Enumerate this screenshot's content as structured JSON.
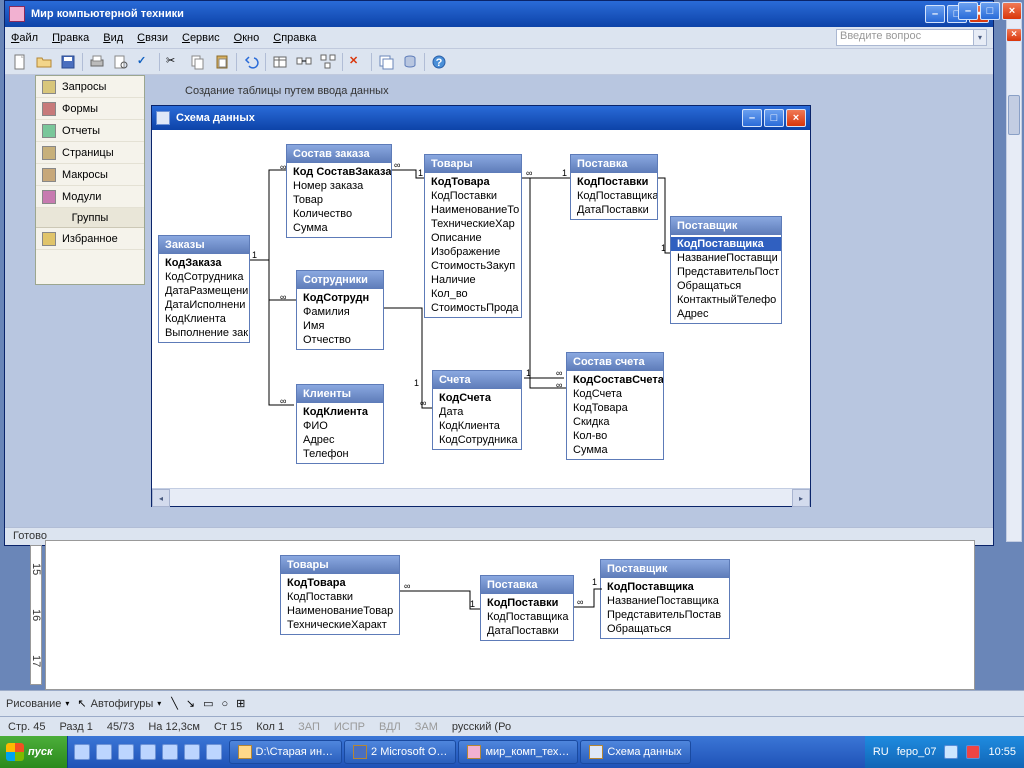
{
  "access_window": {
    "title": "Мир компьютерной техники",
    "menu": [
      "Файл",
      "Правка",
      "Вид",
      "Связи",
      "Сервис",
      "Окно",
      "Справка"
    ],
    "search_placeholder": "Введите вопрос",
    "nav": {
      "queries": "Запросы",
      "forms": "Формы",
      "reports": "Отчеты",
      "pages": "Страницы",
      "macros": "Макросы",
      "modules": "Модули",
      "groups_hdr": "Группы",
      "favorites": "Избранное"
    },
    "wizard_hint": "Создание таблицы путем ввода данных",
    "status": "Готово"
  },
  "schema_window": {
    "title": "Схема данных"
  },
  "tables": {
    "zakazy": {
      "title": "Заказы",
      "fields": [
        "КодЗаказа",
        "КодСотрудника",
        "ДатаРазмещени",
        "ДатаИсполнени",
        "КодКлиента",
        "Выполнение зак"
      ]
    },
    "sostav_zakaza": {
      "title": "Состав заказа",
      "fields": [
        "Код СоставЗаказа",
        "Номер заказа",
        "Товар",
        "Количество",
        "Сумма"
      ]
    },
    "tovary": {
      "title": "Товары",
      "fields": [
        "КодТовара",
        "КодПоставки",
        "НаименованиеТо",
        "ТехническиеХар",
        "Описание",
        "Изображение",
        "СтоимостьЗакуп",
        "Наличие",
        "Кол_во",
        "СтоимостьПрода"
      ]
    },
    "postavka": {
      "title": "Поставка",
      "fields": [
        "КодПоставки",
        "КодПоставщика",
        "ДатаПоставки"
      ]
    },
    "postavshik": {
      "title": "Поставщик",
      "fields": [
        "КодПоставщика",
        "НазваниеПоставщи",
        "ПредставительПост",
        "Обращаться",
        "КонтактныйТелефо",
        "Адрес"
      ]
    },
    "sotrudniki": {
      "title": "Сотрудники",
      "fields": [
        "КодСотрудн",
        "Фамилия",
        "Имя",
        "Отчество"
      ]
    },
    "klienty": {
      "title": "Клиенты",
      "fields": [
        "КодКлиента",
        "ФИО",
        "Адрес",
        "Телефон"
      ]
    },
    "scheta": {
      "title": "Счета",
      "fields": [
        "КодСчета",
        "Дата",
        "КодКлиента",
        "КодСотрудника"
      ]
    },
    "sostav_scheta": {
      "title": "Состав счета",
      "fields": [
        "КодСоставСчета",
        "КодСчета",
        "КодТовара",
        "Скидка",
        "Кол-во",
        "Сумма"
      ]
    }
  },
  "rel_labels": {
    "one": "1",
    "many": "∞"
  },
  "below": {
    "tovary": {
      "title": "Товары",
      "fields": [
        "КодТовара",
        "КодПоставки",
        "НаименованиеТовар",
        "ТехническиеХаракт"
      ]
    },
    "postavka": {
      "title": "Поставка",
      "fields": [
        "КодПоставки",
        "КодПоставщика",
        "ДатаПоставки"
      ]
    },
    "postavshik": {
      "title": "Поставщик",
      "fields": [
        "КодПоставщика",
        "НазваниеПоставщика",
        "ПредставительПостав",
        "Обращаться"
      ]
    }
  },
  "word": {
    "draw_label": "Рисование",
    "autoshapes": "Автофигуры",
    "status": {
      "page": "Стр.  45",
      "section": "Разд 1",
      "pp": "45/73",
      "at": "На  12,3см",
      "line": "Ст  15",
      "col": "Кол  1",
      "zap": "ЗАП",
      "isp": "ИСПР",
      "vdl": "ВДЛ",
      "zam": "ЗАМ",
      "lang": "русский (Ро"
    }
  },
  "taskbar": {
    "start": "пуск",
    "btns": [
      "D:\\Старая ин…",
      "2  Microsoft O…",
      "мир_комп_тех…",
      "Схема данных"
    ],
    "tray_lang": "RU",
    "tray_fepo": "fepo_07",
    "time": "10:55"
  }
}
